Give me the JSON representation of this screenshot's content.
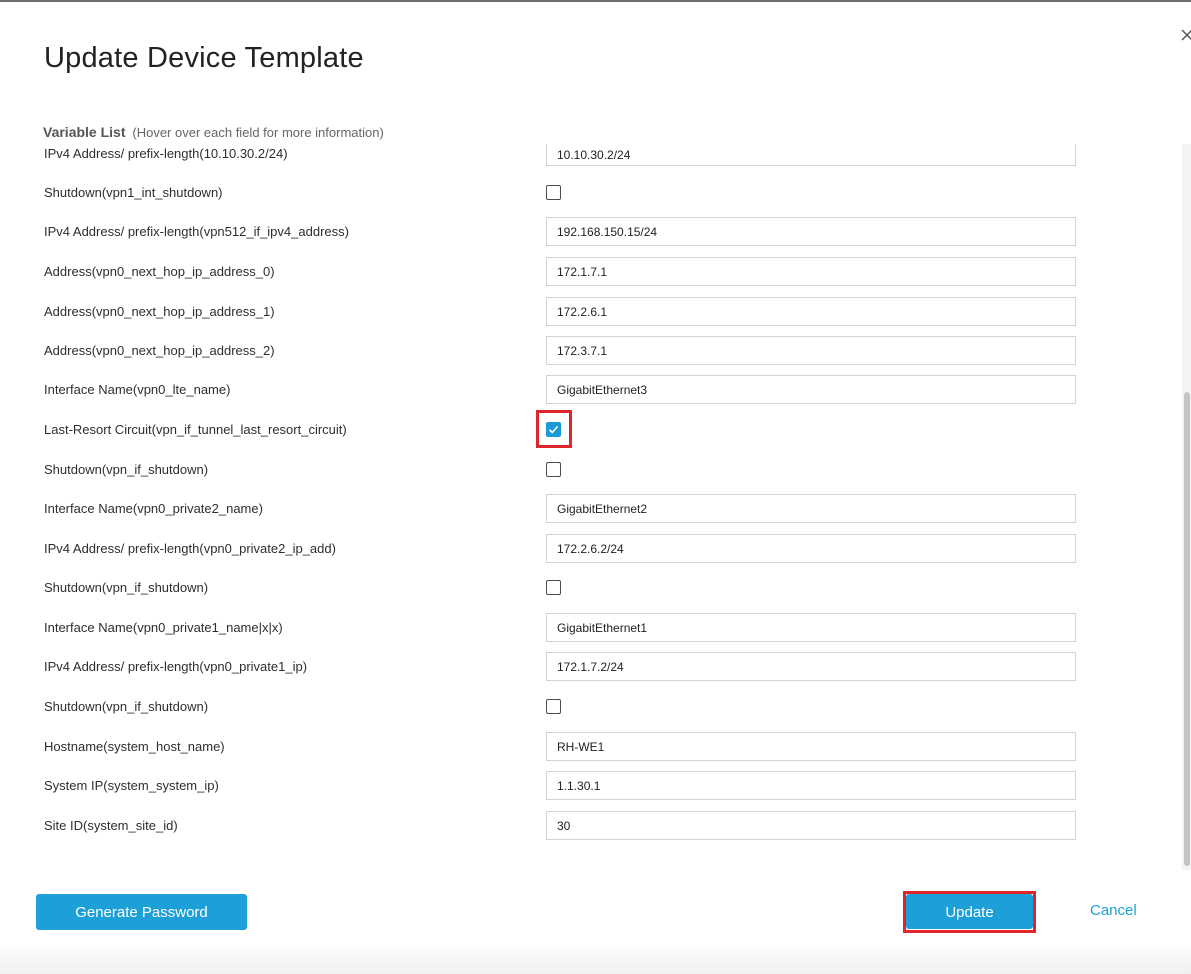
{
  "dialog": {
    "title": "Update Device Template",
    "variable_list_label": "Variable List",
    "variable_list_hint": "(Hover over each field for more information)"
  },
  "rows": [
    {
      "label": "IPv4 Address/ prefix-length(10.10.30.2/24)",
      "type": "text",
      "value": "10.10.30.2/24"
    },
    {
      "label": "Shutdown(vpn1_int_shutdown)",
      "type": "checkbox",
      "checked": false
    },
    {
      "label": "IPv4 Address/ prefix-length(vpn512_if_ipv4_address)",
      "type": "text",
      "value": "192.168.150.15/24"
    },
    {
      "label": "Address(vpn0_next_hop_ip_address_0)",
      "type": "text",
      "value": "172.1.7.1"
    },
    {
      "label": "Address(vpn0_next_hop_ip_address_1)",
      "type": "text",
      "value": "172.2.6.1"
    },
    {
      "label": "Address(vpn0_next_hop_ip_address_2)",
      "type": "text",
      "value": "172.3.7.1"
    },
    {
      "label": "Interface Name(vpn0_lte_name)",
      "type": "text",
      "value": "GigabitEthernet3"
    },
    {
      "label": "Last-Resort Circuit(vpn_if_tunnel_last_resort_circuit)",
      "type": "checkbox",
      "checked": true
    },
    {
      "label": "Shutdown(vpn_if_shutdown)",
      "type": "checkbox",
      "checked": false
    },
    {
      "label": "Interface Name(vpn0_private2_name)",
      "type": "text",
      "value": "GigabitEthernet2"
    },
    {
      "label": "IPv4 Address/ prefix-length(vpn0_private2_ip_add)",
      "type": "text",
      "value": "172.2.6.2/24"
    },
    {
      "label": "Shutdown(vpn_if_shutdown)",
      "type": "checkbox",
      "checked": false
    },
    {
      "label": "Interface Name(vpn0_private1_name|x|x)",
      "type": "text",
      "value": "GigabitEthernet1"
    },
    {
      "label": "IPv4 Address/ prefix-length(vpn0_private1_ip)",
      "type": "text",
      "value": "172.1.7.2/24"
    },
    {
      "label": "Shutdown(vpn_if_shutdown)",
      "type": "checkbox",
      "checked": false
    },
    {
      "label": "Hostname(system_host_name)",
      "type": "text",
      "value": "RH-WE1"
    },
    {
      "label": "System IP(system_system_ip)",
      "type": "text",
      "value": "1.1.30.1"
    },
    {
      "label": "Site ID(system_site_id)",
      "type": "text",
      "value": "30"
    }
  ],
  "footer": {
    "generate_password_label": "Generate Password",
    "update_label": "Update",
    "cancel_label": "Cancel"
  },
  "icons": {
    "close": "close-icon",
    "check": "check-icon"
  },
  "colors": {
    "accent": "#1d9fd8",
    "highlight": "#e0262c"
  }
}
